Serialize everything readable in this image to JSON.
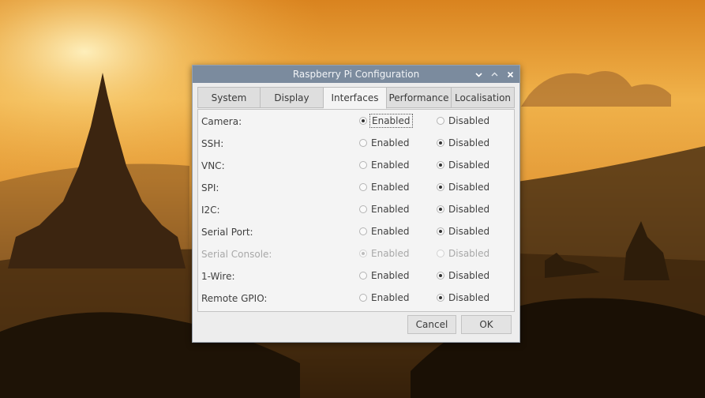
{
  "window": {
    "title": "Raspberry Pi Configuration",
    "titlebar_color": "#7b8b9e"
  },
  "tabs": [
    {
      "label": "System",
      "active": false
    },
    {
      "label": "Display",
      "active": false
    },
    {
      "label": "Interfaces",
      "active": true
    },
    {
      "label": "Performance",
      "active": false
    },
    {
      "label": "Localisation",
      "active": false
    }
  ],
  "radio_labels": {
    "enabled": "Enabled",
    "disabled": "Disabled"
  },
  "interfaces": [
    {
      "label": "Camera:",
      "selected": "enabled",
      "disabled": false
    },
    {
      "label": "SSH:",
      "selected": "disabled",
      "disabled": false
    },
    {
      "label": "VNC:",
      "selected": "disabled",
      "disabled": false
    },
    {
      "label": "SPI:",
      "selected": "disabled",
      "disabled": false
    },
    {
      "label": "I2C:",
      "selected": "disabled",
      "disabled": false
    },
    {
      "label": "Serial Port:",
      "selected": "disabled",
      "disabled": false
    },
    {
      "label": "Serial Console:",
      "selected": "enabled",
      "disabled": true
    },
    {
      "label": "1-Wire:",
      "selected": "disabled",
      "disabled": false
    },
    {
      "label": "Remote GPIO:",
      "selected": "disabled",
      "disabled": false
    }
  ],
  "buttons": {
    "cancel": "Cancel",
    "ok": "OK"
  },
  "icons": {
    "minimize": "chevron-down-icon",
    "maximize": "chevron-up-icon",
    "close": "close-icon"
  }
}
